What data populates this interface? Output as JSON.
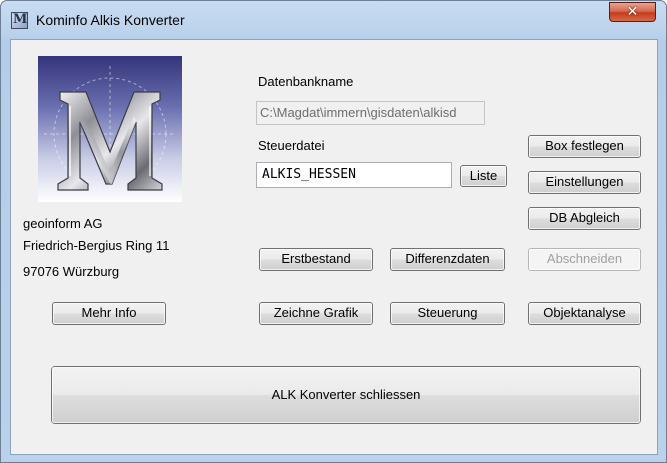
{
  "window": {
    "title": "Kominfo Alkis Konverter",
    "close_symbol": "✕"
  },
  "company": {
    "name": "geoinform AG",
    "street": "Friedrich-Bergius Ring 11",
    "city": "97076 Würzburg"
  },
  "datenbank": {
    "label": "Datenbankname",
    "value": "C:\\Magdat\\immern\\gisdaten\\alkisd"
  },
  "steuerdatei": {
    "label": "Steuerdatei",
    "value": "ALKIS_HESSEN"
  },
  "buttons": {
    "liste": "Liste",
    "box_festlegen": "Box festlegen",
    "einstellungen": "Einstellungen",
    "db_abgleich": "DB Abgleich",
    "erstbestand": "Erstbestand",
    "differenzdaten": "Differenzdaten",
    "abschneiden": "Abschneiden",
    "mehr_info": "Mehr Info",
    "zeichne_grafik": "Zeichne Grafik",
    "steuerung": "Steuerung",
    "objektanalyse": "Objektanalyse",
    "schliessen": "ALK Konverter schliessen"
  },
  "icons": {
    "app": "app-icon",
    "close": "close-icon",
    "logo": "m-logo"
  },
  "colors": {
    "close_button": "#c94a2c",
    "dialog_background": "#f0f0f0",
    "title_bar": "#bcd3ec"
  }
}
